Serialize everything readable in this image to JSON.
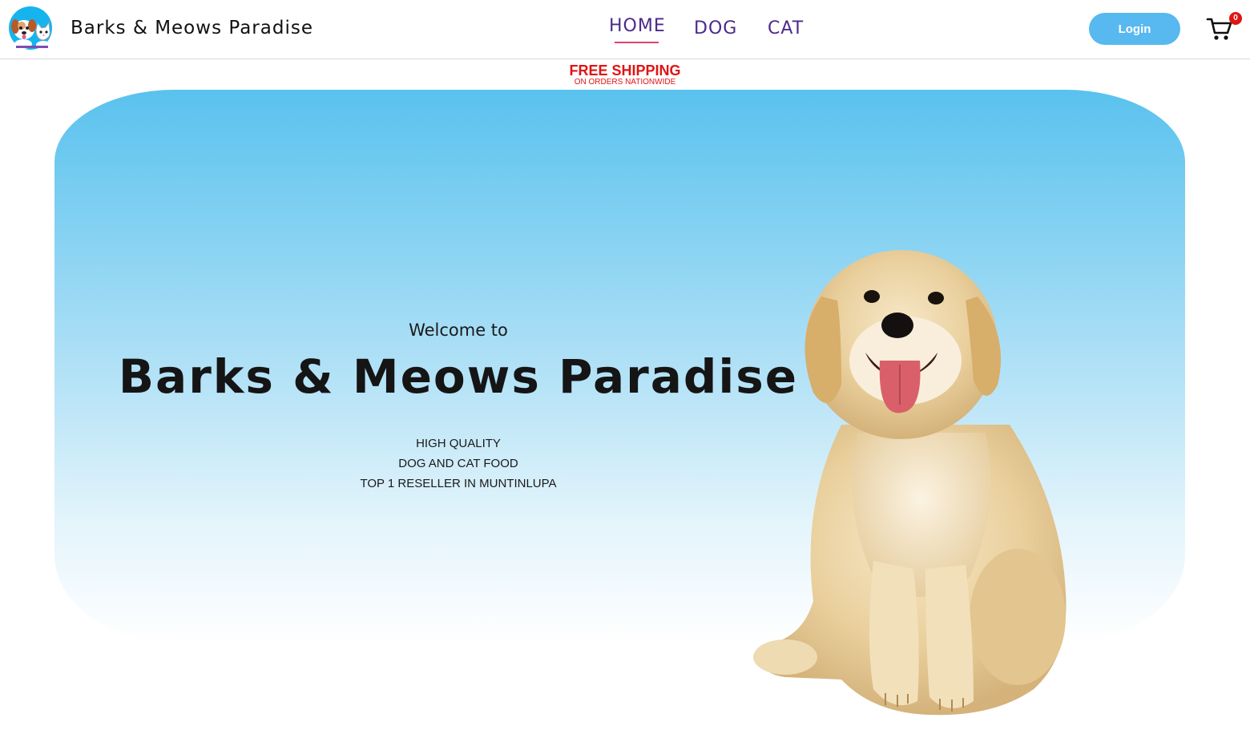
{
  "header": {
    "brand": "Barks & Meows Paradise",
    "nav": [
      {
        "label": "HOME",
        "active": true
      },
      {
        "label": "DOG",
        "active": false
      },
      {
        "label": "CAT",
        "active": false
      }
    ],
    "login_label": "Login",
    "cart_count": "0"
  },
  "banner": {
    "main": "FREE SHIPPING",
    "sub": "ON ORDERS NATIONWIDE"
  },
  "hero": {
    "welcome": "Welcome to",
    "title": "Barks & Meows Paradise",
    "tagline": [
      "HIGH QUALITY",
      "DOG AND CAT FOOD",
      "TOP 1 RESELLER IN MUNTINLUPA"
    ]
  },
  "colors": {
    "accent": "#58b8f0",
    "nav_text": "#4b2a8c",
    "nav_underline": "#e1416d",
    "banner_red": "#e01414",
    "hero_top": "#59c2ee"
  },
  "icons": [
    "dog-and-cat-logo",
    "shopping-cart-icon",
    "golden-retriever-puppy"
  ]
}
